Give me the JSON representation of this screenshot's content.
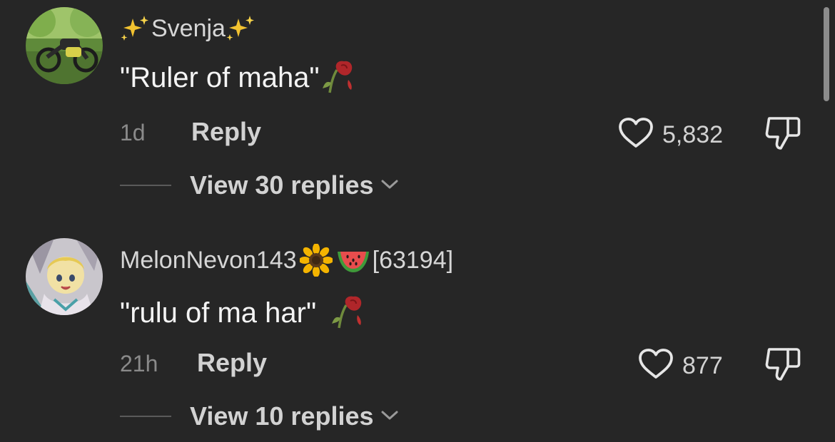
{
  "comments": [
    {
      "username_prefix_icon": "sparkles-icon",
      "username": "Svenja",
      "username_suffix_icon": "sparkles-icon",
      "text": "\"Ruler of maha\"",
      "text_emoji": "wilted-flower-icon",
      "time": "1d",
      "reply_label": "Reply",
      "like_count": "5,832",
      "view_replies_label": "View 30 replies"
    },
    {
      "username": "MelonNevon143",
      "username_icons": [
        "sunflower-icon",
        "watermelon-icon"
      ],
      "username_tag": "[63194]",
      "text": "\"rulu of ma har\"",
      "text_emoji": "wilted-flower-icon",
      "time": "21h",
      "reply_label": "Reply",
      "like_count": "877",
      "view_replies_label": "View 10 replies"
    }
  ],
  "colors": {
    "background": "#262626",
    "primary_text": "#f4f4f4",
    "secondary_text": "#d2d2d2",
    "muted_text": "#8a8a8a"
  }
}
